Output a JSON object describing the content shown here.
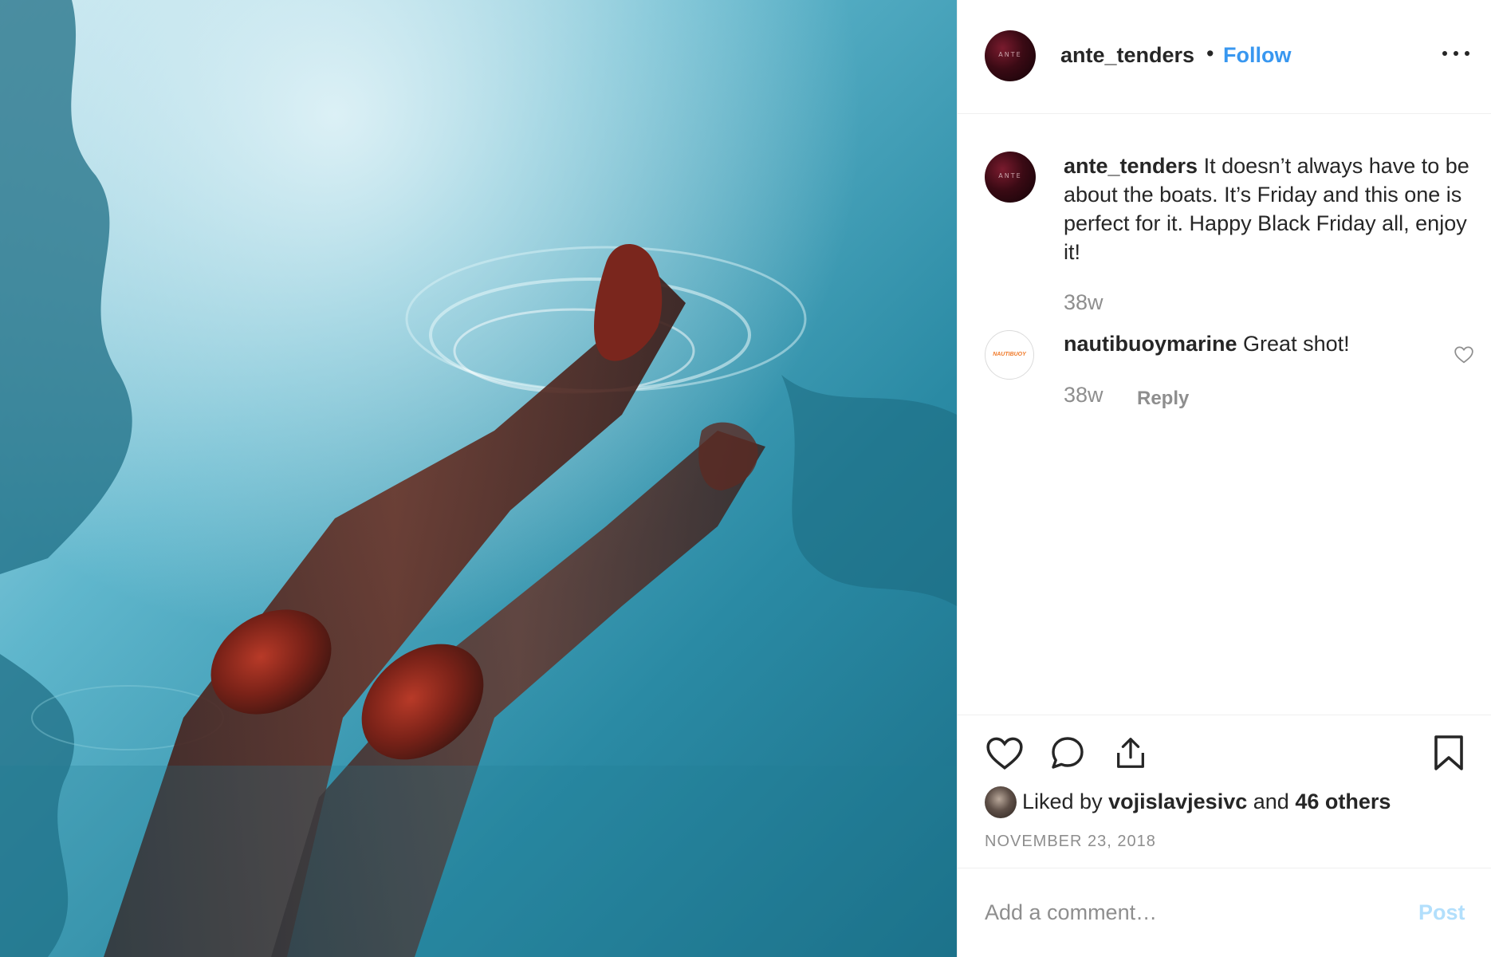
{
  "post": {
    "username": "ante_tenders",
    "separator": "•",
    "follow_label": "Follow",
    "more_icon": "more-horizontal-icon",
    "avatar_text": "ANTE"
  },
  "caption": {
    "username": "ante_tenders",
    "text": "It doesn’t always have to be about the boats. It’s Friday and this one is perfect for it. Happy Black Friday all, enjoy it!",
    "time": "38w"
  },
  "comments": [
    {
      "username": "nautibuoymarine",
      "text": "Great shot!",
      "time": "38w",
      "reply_label": "Reply",
      "avatar_text": "NAUTIBUOY"
    }
  ],
  "actions": {
    "like_icon": "heart-icon",
    "comment_icon": "comment-icon",
    "share_icon": "share-icon",
    "save_icon": "bookmark-icon"
  },
  "likes": {
    "prefix": "Liked by",
    "user": "vojislavjesivc",
    "and": "and",
    "others": "46 others"
  },
  "date": "NOVEMBER 23, 2018",
  "comment_box": {
    "placeholder": "Add a comment…",
    "post_label": "Post"
  },
  "colors": {
    "accent": "#3897f0",
    "text": "#262626",
    "muted": "#8e8e8e",
    "post_disabled": "#b2dffc",
    "water": "#2b8aa3"
  }
}
